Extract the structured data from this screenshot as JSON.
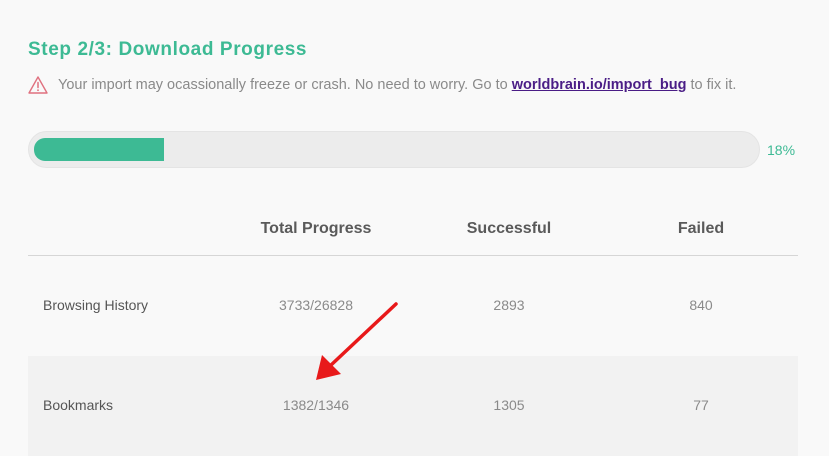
{
  "step_title": "Step 2/3: Download Progress",
  "warning": {
    "icon": "warning-triangle-icon",
    "text_before": "Your import may ocassionally freeze or crash. No need to worry. Go to",
    "link_text": "worldbrain.io/import_bug",
    "text_after": "to fix it."
  },
  "progress": {
    "percent_label": "18%",
    "fraction": 0.18,
    "color": "#3dba94"
  },
  "table": {
    "headers": [
      "",
      "Total Progress",
      "Successful",
      "Failed"
    ],
    "rows": [
      {
        "label": "Browsing History",
        "total": "3733/26828",
        "successful": "2893",
        "failed": "840"
      },
      {
        "label": "Bookmarks",
        "total": "1382/1346",
        "successful": "1305",
        "failed": "77"
      }
    ]
  },
  "annotation": {
    "arrow_color": "#e8191a"
  }
}
